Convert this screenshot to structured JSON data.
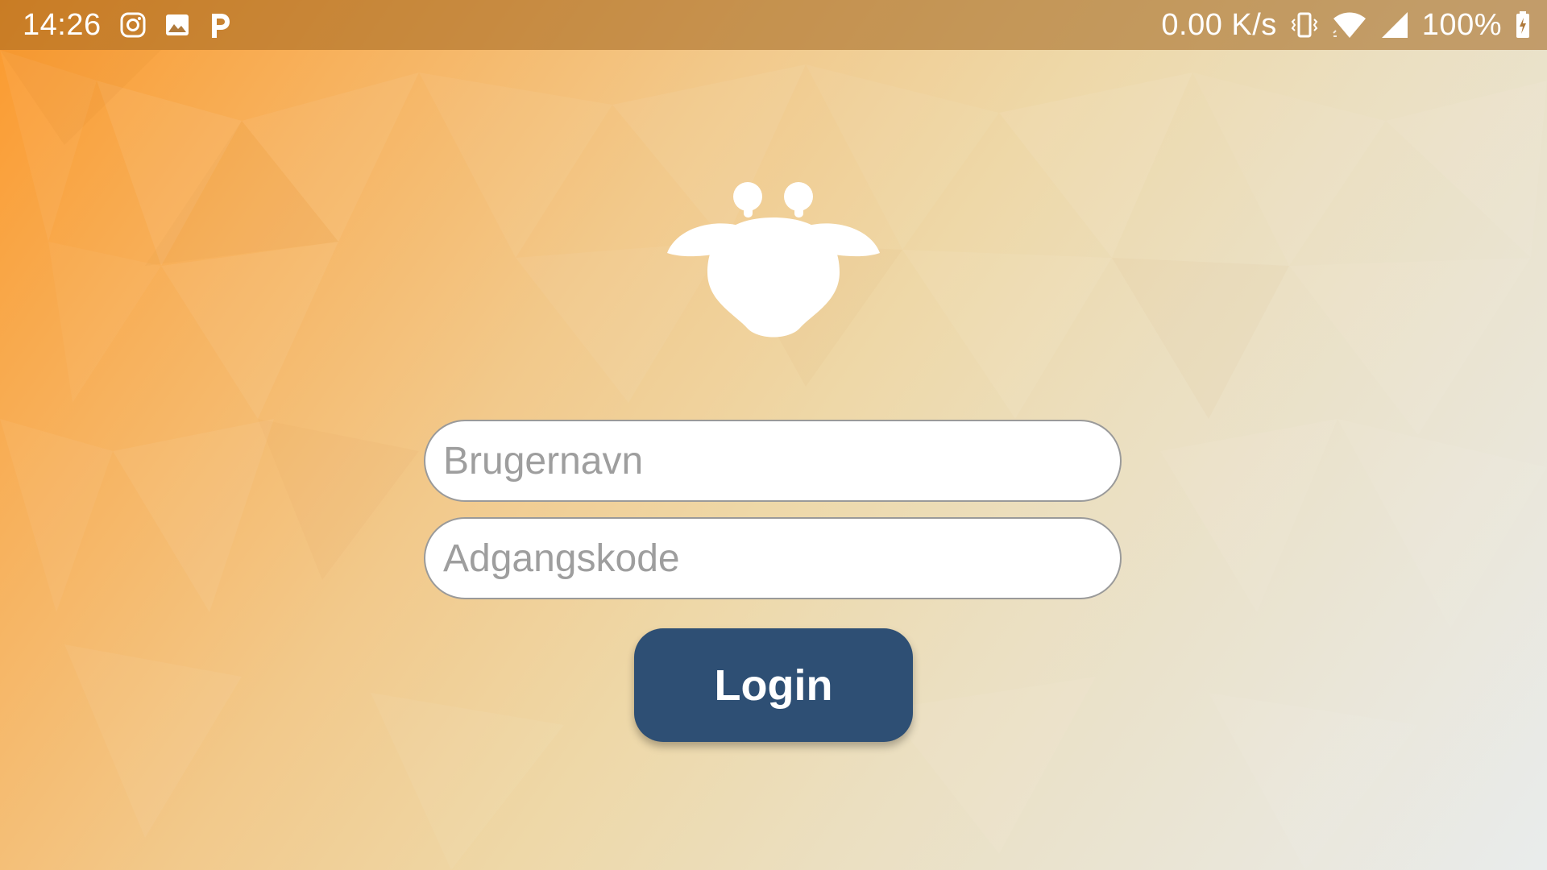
{
  "status_bar": {
    "time": "14:26",
    "network_speed": "0.00 K/s",
    "battery_percent": "100%",
    "left_icons": [
      "instagram-icon",
      "gallery-icon",
      "p-app-icon"
    ],
    "right_icons": [
      "vibrate-icon",
      "wifi-icon",
      "cell-signal-icon",
      "battery-charging-icon"
    ]
  },
  "logo": {
    "icon": "giraffe-head-logo"
  },
  "form": {
    "username_placeholder": "Brugernavn",
    "password_placeholder": "Adgangskode",
    "login_label": "Login"
  },
  "colors": {
    "button_bg": "#2e4f74",
    "gradient_start": "#fb9a2e",
    "gradient_end": "#e9ecec"
  }
}
